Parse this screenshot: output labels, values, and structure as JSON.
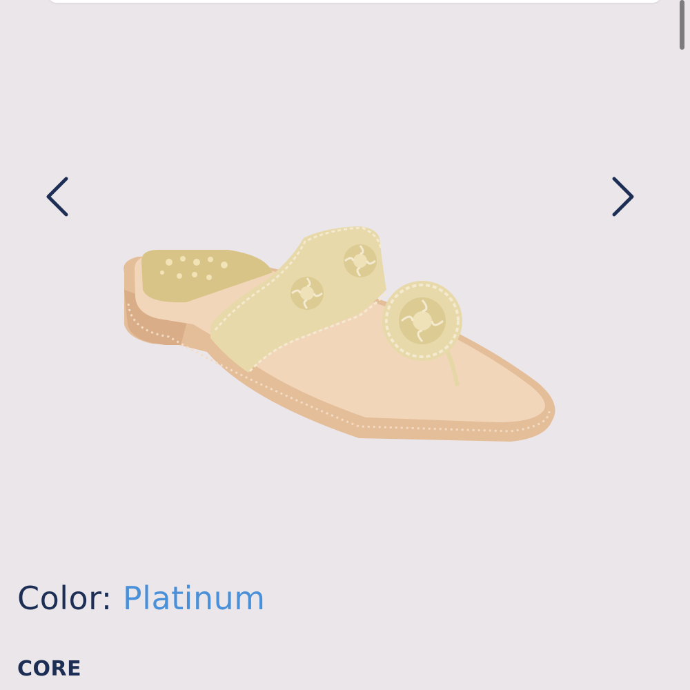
{
  "carousel": {
    "prev_icon": "chevron-left-icon",
    "next_icon": "chevron-right-icon",
    "arrow_color": "#1c2e54",
    "image": {
      "subject": "metallic gold thong sandal",
      "colors": {
        "strap": "#e6d7a6",
        "sole": "#ebc9a6",
        "footbed": "#f1d5b8"
      }
    }
  },
  "product": {
    "color_label": "Color:",
    "color_value": "Platinum",
    "collection": "CORE"
  },
  "theme": {
    "background": "#ebe6e9",
    "heading": "#1c2e54",
    "accent": "#4a90d9"
  }
}
